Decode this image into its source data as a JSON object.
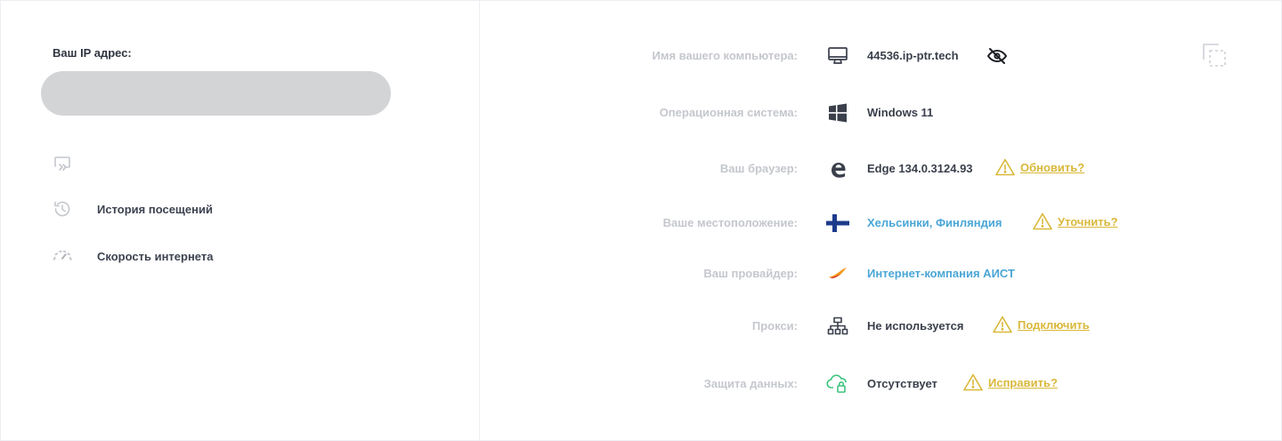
{
  "left": {
    "ip_label": "Ваш IP адрес:",
    "menu": [
      {
        "icon": "cast-icon",
        "label": ""
      },
      {
        "icon": "history-icon",
        "label": "История посещений"
      },
      {
        "icon": "speedometer-icon",
        "label": "Скорость интернета"
      }
    ]
  },
  "right": {
    "rows": [
      {
        "label": "Имя вашего компьютера:",
        "icon": "monitor-icon",
        "value": "44536.ip-ptr.tech",
        "extra_icon": "eye-slash-icon"
      },
      {
        "label": "Операционная система:",
        "icon": "windows-icon",
        "value": "Windows 11"
      },
      {
        "label": "Ваш браузер:",
        "icon": "edge-icon",
        "value": "Edge 134.0.3124.93",
        "action": "Обновить?"
      },
      {
        "label": "Ваше местоположение:",
        "icon": "finland-flag-icon",
        "value": "Хельсинки, Финляндия",
        "action": "Уточнить?"
      },
      {
        "label": "Ваш провайдер:",
        "icon": "isp-logo-icon",
        "value": "Интернет-компания АИСТ"
      },
      {
        "label": "Прокси:",
        "icon": "network-icon",
        "value": "Не используется",
        "action": "Подключить"
      },
      {
        "label": "Защита данных:",
        "icon": "cloud-lock-icon",
        "value": "Отсутствует",
        "action": "Исправить?"
      }
    ],
    "copy_icon": "copy-icon"
  },
  "colors": {
    "label": "#c4c7cd",
    "value": "#3a3f4b",
    "link_blue": "#4aa6d6",
    "warning": "#d9b83a",
    "redacted": "#d3d4d6",
    "cloud_green": "#3dc47e"
  }
}
